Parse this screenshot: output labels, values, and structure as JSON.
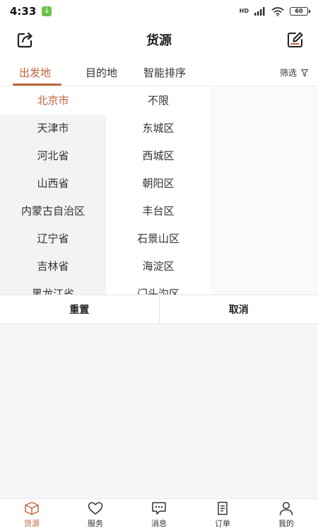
{
  "status": {
    "time": "4:33",
    "network": "HD",
    "battery": "60"
  },
  "header": {
    "title": "货源"
  },
  "tabs": [
    {
      "label": "出发地",
      "active": true
    },
    {
      "label": "目的地",
      "active": false
    },
    {
      "label": "智能排序",
      "active": false
    }
  ],
  "filter": {
    "label": "筛选"
  },
  "provinces": [
    "北京市",
    "天津市",
    "河北省",
    "山西省",
    "内蒙古自治区",
    "辽宁省",
    "吉林省",
    "黑龙江省"
  ],
  "districts": [
    "不限",
    "东城区",
    "西城区",
    "朝阳区",
    "丰台区",
    "石景山区",
    "海淀区",
    "门头沟区"
  ],
  "actions": {
    "reset": "重置",
    "cancel": "取消"
  },
  "nav": [
    {
      "label": "货源",
      "icon": "box-icon",
      "active": true
    },
    {
      "label": "服务",
      "icon": "heart-icon",
      "active": false
    },
    {
      "label": "消息",
      "icon": "message-icon",
      "active": false
    },
    {
      "label": "订单",
      "icon": "document-icon",
      "active": false
    },
    {
      "label": "我的",
      "icon": "person-icon",
      "active": false
    }
  ],
  "colors": {
    "accent": "#c0643b"
  }
}
